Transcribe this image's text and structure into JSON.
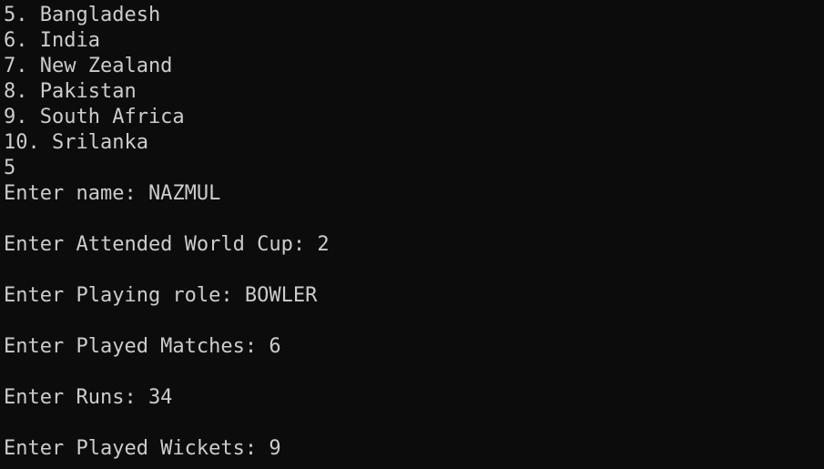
{
  "terminal": {
    "colors": {
      "background": "#0c0c0c",
      "foreground": "#cccccc"
    },
    "lines": [
      "5. Bangladesh",
      "6. India",
      "7. New Zealand",
      "8. Pakistan",
      "9. South Africa",
      "10. Srilanka",
      "5",
      "Enter name: NAZMUL",
      "",
      "Enter Attended World Cup: 2",
      "",
      "Enter Playing role: BOWLER",
      "",
      "Enter Played Matches: 6",
      "",
      "Enter Runs: 34",
      "",
      "Enter Played Wickets: 9"
    ]
  }
}
